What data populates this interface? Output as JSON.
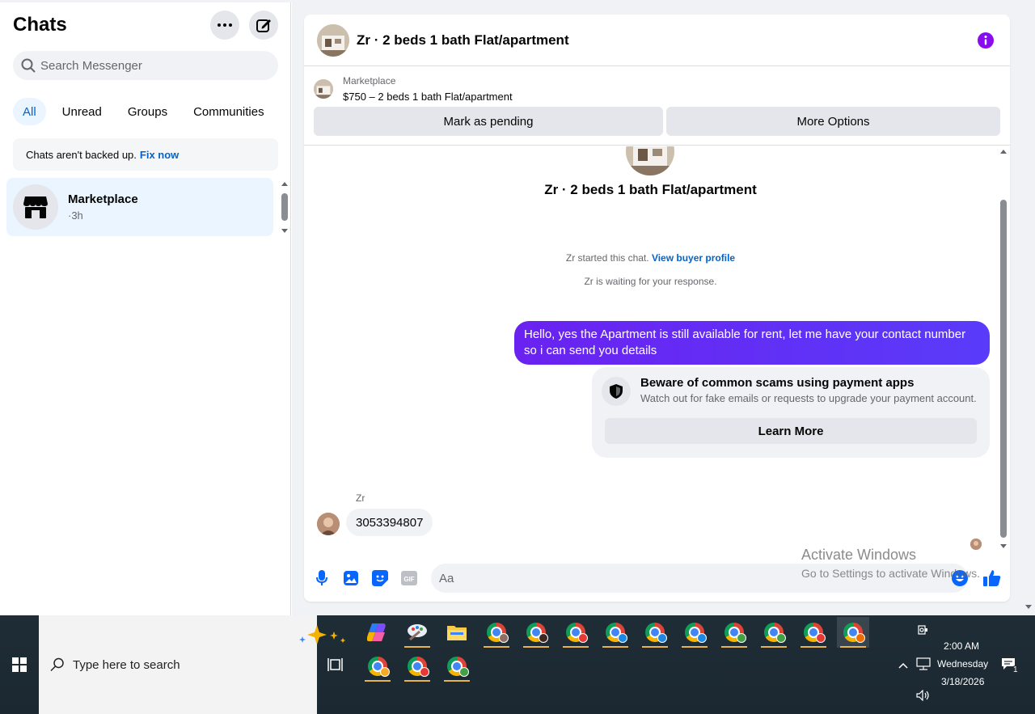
{
  "sidebar": {
    "title": "Chats",
    "search_placeholder": "Search Messenger",
    "filters": [
      "All",
      "Unread",
      "Groups",
      "Communities"
    ],
    "backup_notice": "Chats aren't backed up.",
    "backup_link": "Fix now",
    "chats": [
      {
        "name": "Marketplace",
        "time": "·3h"
      }
    ]
  },
  "conversation": {
    "title": "Zr · 2 beds 1 bath Flat/apartment",
    "marketplace_label": "Marketplace",
    "listing": "$750 – 2 beds 1 bath Flat/apartment",
    "mark_pending": "Mark as pending",
    "more_options": "More Options",
    "intro_title": "Zr · 2 beds 1 bath Flat/apartment",
    "started_text": "Zr started this chat.",
    "buyer_profile_link": "View buyer profile",
    "waiting_text": "Zr is waiting for your response.",
    "outgoing_message": "Hello, yes the Apartment is still available for rent, let me have your contact number so i can send you details",
    "scam_title": "Beware of common scams using payment apps",
    "scam_sub": "Watch out for fake emails or requests to upgrade your payment account.",
    "learn_more": "Learn More",
    "incoming_sender": "Zr",
    "incoming_message": "3053394807",
    "composer_placeholder": "Aa",
    "accent_color": "#5b2dfc"
  },
  "watermark": {
    "line1": "Activate Windows",
    "line2": "Go to Settings to activate Windows."
  },
  "taskbar": {
    "search_placeholder": "Type here to search",
    "time": "2:00 AM",
    "day": "Wednesday",
    "date": "3/18/2026",
    "notification_count": "1",
    "apps": [
      "copilot",
      "paint",
      "file-explorer",
      "chrome",
      "chrome",
      "chrome",
      "chrome",
      "chrome",
      "chrome",
      "chrome",
      "chrome",
      "chrome",
      "chrome",
      "chrome",
      "chrome",
      "chrome"
    ]
  }
}
